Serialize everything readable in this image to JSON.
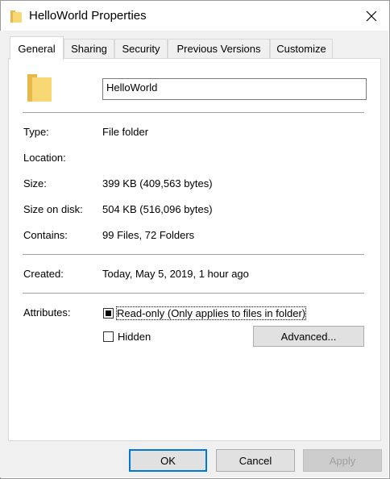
{
  "window": {
    "title": "HelloWorld Properties",
    "close_icon": "close-icon",
    "folder_color": "#f8d775"
  },
  "tabs": [
    {
      "label": "General",
      "active": true
    },
    {
      "label": "Sharing",
      "active": false
    },
    {
      "label": "Security",
      "active": false
    },
    {
      "label": "Previous Versions",
      "active": false
    },
    {
      "label": "Customize",
      "active": false
    }
  ],
  "general": {
    "folder_icon": "folder-icon",
    "name_value": "HelloWorld",
    "rows": [
      {
        "label": "Type:",
        "value": "File folder"
      },
      {
        "label": "Location:",
        "value": ""
      },
      {
        "label": "Size:",
        "value": "399 KB (409,563 bytes)"
      },
      {
        "label": "Size on disk:",
        "value": "504 KB (516,096 bytes)"
      },
      {
        "label": "Contains:",
        "value": "99 Files, 72 Folders"
      }
    ],
    "created": {
      "label": "Created:",
      "value": "Today, May 5, 2019, 1 hour ago"
    },
    "attributes": {
      "label": "Attributes:",
      "readonly": {
        "label": "Read-only (Only applies to files in folder)",
        "state": "indeterminate"
      },
      "hidden": {
        "label": "Hidden",
        "checked": false
      },
      "advanced_label": "Advanced..."
    }
  },
  "buttons": {
    "ok": "OK",
    "cancel": "Cancel",
    "apply": "Apply"
  }
}
